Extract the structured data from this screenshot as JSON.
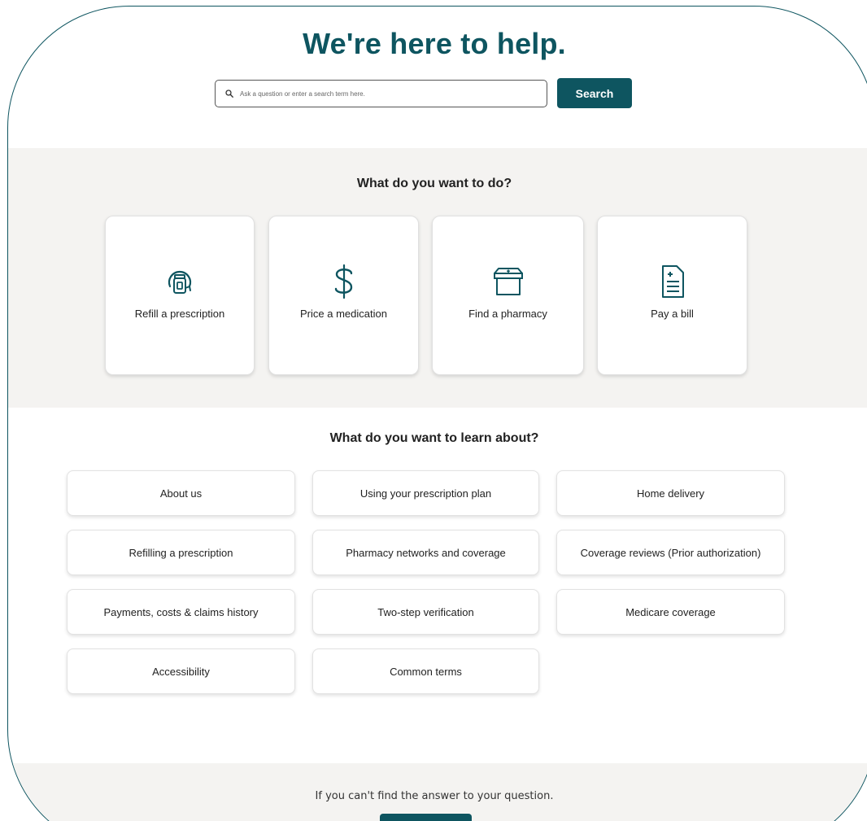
{
  "hero": {
    "title": "We're here to help.",
    "search_placeholder": "Ask a question or enter a search term here.",
    "search_button": "Search"
  },
  "actions": {
    "heading": "What do you want to do?",
    "items": [
      {
        "label": "Refill a prescription",
        "icon": "refill-bottle-icon"
      },
      {
        "label": "Price a medication",
        "icon": "dollar-icon"
      },
      {
        "label": "Find a pharmacy",
        "icon": "pharmacy-store-icon"
      },
      {
        "label": "Pay a bill",
        "icon": "bill-document-icon"
      }
    ]
  },
  "topics": {
    "heading": "What do you want to learn about?",
    "items": [
      "About us",
      "Using your prescription plan",
      "Home delivery",
      "Refilling a prescription",
      "Pharmacy networks and coverage",
      "Coverage reviews (Prior authorization)",
      "Payments, costs & claims history",
      "Two-step verification",
      "Medicare coverage",
      "Accessibility",
      "Common terms"
    ]
  },
  "footer": {
    "text": "If you can't find the answer to your question."
  },
  "colors": {
    "brand": "#0e5560",
    "band_background": "#f4f3f1"
  }
}
